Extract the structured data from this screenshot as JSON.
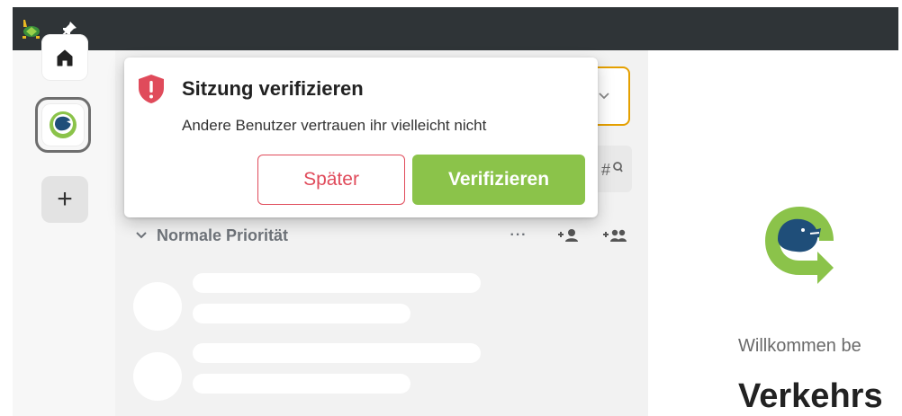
{
  "window": {
    "app_icon": "turtle-app-icon",
    "pin_icon": "pin-icon"
  },
  "spaces": {
    "home_icon": "home-icon",
    "active_space_icon": "lion-logo-icon",
    "add_icon": "plus-icon",
    "add_label": "+"
  },
  "roomlist": {
    "section_title": "Normale Priorität",
    "more_label": "···",
    "dropdown_icon": "chevron-down-icon",
    "explore_icon": "explore-rooms-icon"
  },
  "toast": {
    "title": "Sitzung verifizieren",
    "description": "Andere Benutzer vertrauen ihr vielleicht nicht",
    "later_label": "Später",
    "verify_label": "Verifizieren",
    "icon": "shield-warning-icon",
    "accent_color": "#e04b5b",
    "verify_color": "#8bc34a"
  },
  "main": {
    "welcome_text": "Willkommen be",
    "welcome_title": "Verkehrs",
    "logo_icon": "lion-logo-icon"
  }
}
